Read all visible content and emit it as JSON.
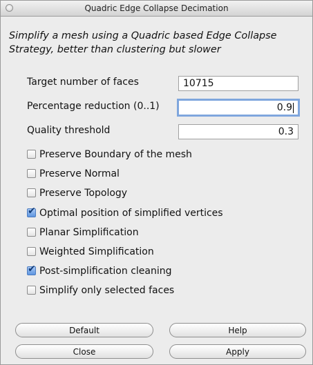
{
  "window": {
    "title": "Quadric Edge Collapse Decimation"
  },
  "description": "Simplify a mesh using a Quadric based Edge Collapse Strategy, better than clustering but slower",
  "params": [
    {
      "label": "Target number of faces",
      "value": "10715",
      "align": "left"
    },
    {
      "label": "Percentage reduction (0..1)",
      "value": "0.9",
      "focused": true
    },
    {
      "label": "Quality threshold",
      "value": "0.3"
    }
  ],
  "options": [
    {
      "label": "Preserve Boundary of the mesh",
      "checked": false
    },
    {
      "label": "Preserve Normal",
      "checked": false
    },
    {
      "label": "Preserve Topology",
      "checked": false
    },
    {
      "label": "Optimal position of simplified vertices",
      "checked": true
    },
    {
      "label": "Planar Simplification",
      "checked": false
    },
    {
      "label": "Weighted Simplification",
      "checked": false
    },
    {
      "label": "Post-simplification cleaning",
      "checked": true
    },
    {
      "label": "Simplify only selected faces",
      "checked": false
    }
  ],
  "buttons": {
    "default": "Default",
    "help": "Help",
    "close": "Close",
    "apply": "Apply"
  },
  "colors": {
    "checkbox_checked": "#5d95e0",
    "focus_ring": "#7fa6dd"
  }
}
